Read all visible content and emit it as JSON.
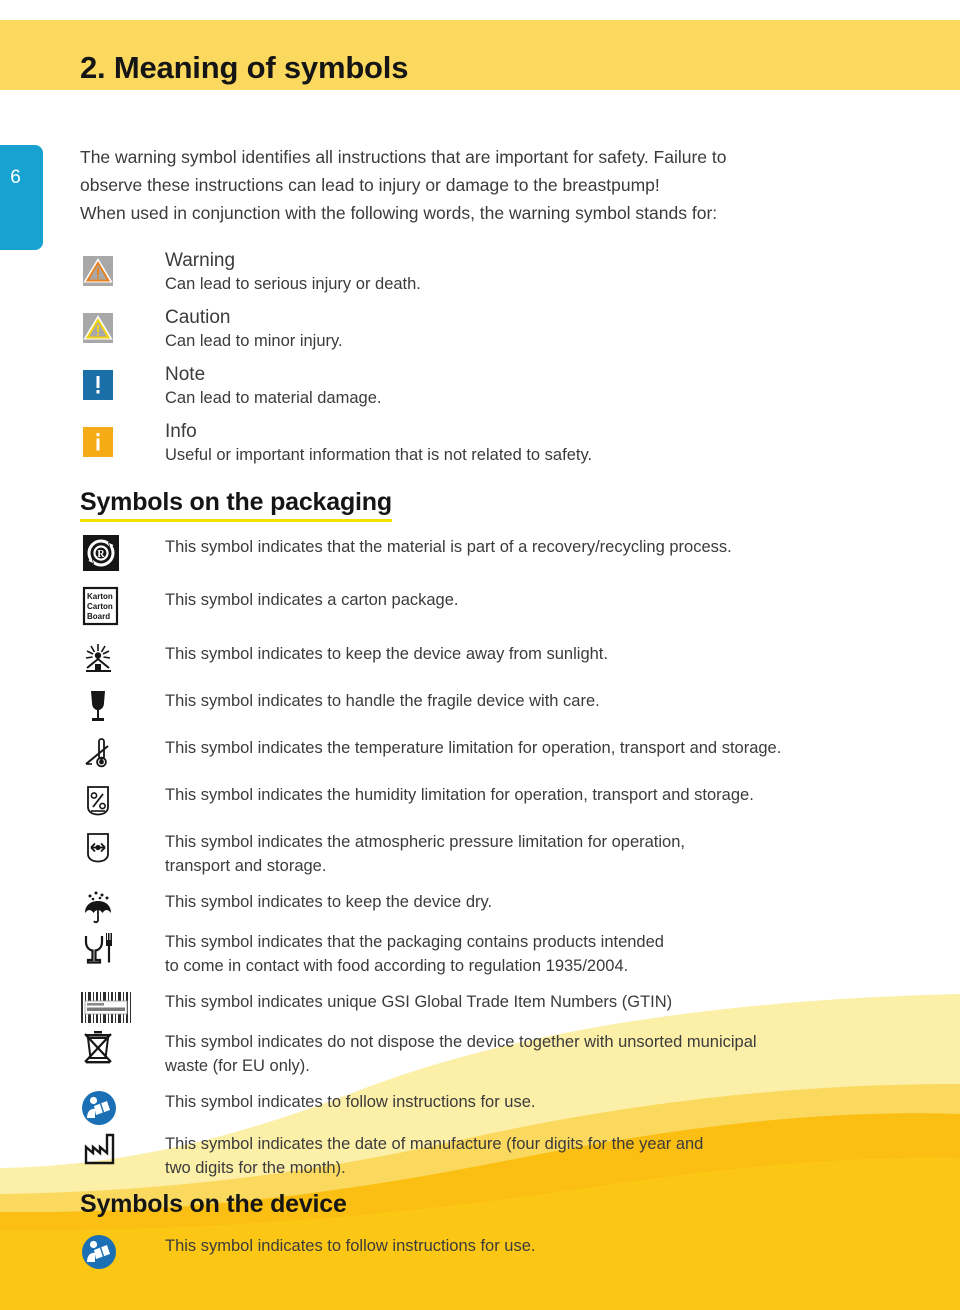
{
  "colors": {
    "header_band": "#FBD95F",
    "page_tab": "#17A2D2",
    "heading_underline": "#F2E200",
    "wave_light": "#FCEFA8",
    "wave_mid": "#FBD95F",
    "wave_deep": "#FBBE12",
    "body_text": "#3B3B3B",
    "note_blue": "#1B6FA8",
    "info_yellow": "#F5AB16",
    "instruction_blue": "#1A6FB5"
  },
  "header": {
    "chapter_number": "2.",
    "title": "2. Meaning of symbols"
  },
  "page_tab": {
    "number": "6"
  },
  "intro": {
    "line1": "The warning symbol identifies all instructions that are important for safety. Failure to",
    "line2": "observe these instructions can lead to injury or damage to the breastpump!",
    "line3": "When used in conjunction with the following words, the warning symbol stands for:"
  },
  "warning_terms": [
    {
      "icon": "warning-triangle-orange-icon",
      "term": "Warning",
      "description": "Can lead to serious injury or death."
    },
    {
      "icon": "caution-triangle-yellow-icon",
      "term": "Caution",
      "description": "Can lead to minor injury."
    },
    {
      "icon": "note-exclamation-icon",
      "term": "Note",
      "description": "Can lead to material damage."
    },
    {
      "icon": "info-i-icon",
      "term": "Info",
      "description": "Useful or important information that is not related to safety."
    }
  ],
  "packaging_section": {
    "heading": "Symbols on the packaging",
    "symbols": [
      {
        "icon": "recycling-resy-icon",
        "line1": "This symbol indicates that the material is part of a recovery/recycling process.",
        "line2": ""
      },
      {
        "icon": "carton-package-icon",
        "icon_text_1": "Karton",
        "icon_text_2": "Carton",
        "icon_text_3": "Board",
        "line1": "This symbol indicates a carton package.",
        "line2": ""
      },
      {
        "icon": "keep-away-from-sunlight-icon",
        "line1": "This symbol indicates to keep the device away from sunlight.",
        "line2": ""
      },
      {
        "icon": "fragile-glass-icon",
        "line1": "This symbol indicates to handle the fragile device with care.",
        "line2": ""
      },
      {
        "icon": "temperature-limitation-icon",
        "line1": "This symbol indicates the temperature limitation for operation, transport and storage.",
        "line2": ""
      },
      {
        "icon": "humidity-limitation-icon",
        "line1": "This symbol indicates the humidity limitation for operation, transport and storage.",
        "line2": ""
      },
      {
        "icon": "atmospheric-pressure-limitation-icon",
        "line1": "This symbol indicates the atmospheric pressure limitation for operation,",
        "line2": "transport and storage."
      },
      {
        "icon": "keep-dry-umbrella-icon",
        "line1": "This symbol indicates to keep the device dry.",
        "line2": ""
      },
      {
        "icon": "food-contact-safe-icon",
        "line1": "This symbol indicates that the packaging contains products intended",
        "line2": "to come in contact with food according to regulation 1935/2004."
      },
      {
        "icon": "barcode-gtin-icon",
        "line1": "This symbol indicates unique GSI Global Trade Item Numbers (GTIN)",
        "line2": ""
      },
      {
        "icon": "weee-crossed-out-bin-icon",
        "line1": "This symbol indicates do not dispose the device together with unsorted municipal",
        "line2": "waste (for EU only)."
      },
      {
        "icon": "follow-instructions-for-use-icon",
        "line1": "This symbol indicates to follow instructions for use.",
        "line2": ""
      },
      {
        "icon": "date-of-manufacture-factory-icon",
        "line1": "This symbol indicates the date of manufacture (four digits for the year and",
        "line2": "two digits for the month)."
      }
    ]
  },
  "device_section": {
    "heading": "Symbols on the device",
    "symbols": [
      {
        "icon": "follow-instructions-for-use-icon",
        "line1": "This symbol indicates to follow instructions for use.",
        "line2": ""
      }
    ]
  }
}
